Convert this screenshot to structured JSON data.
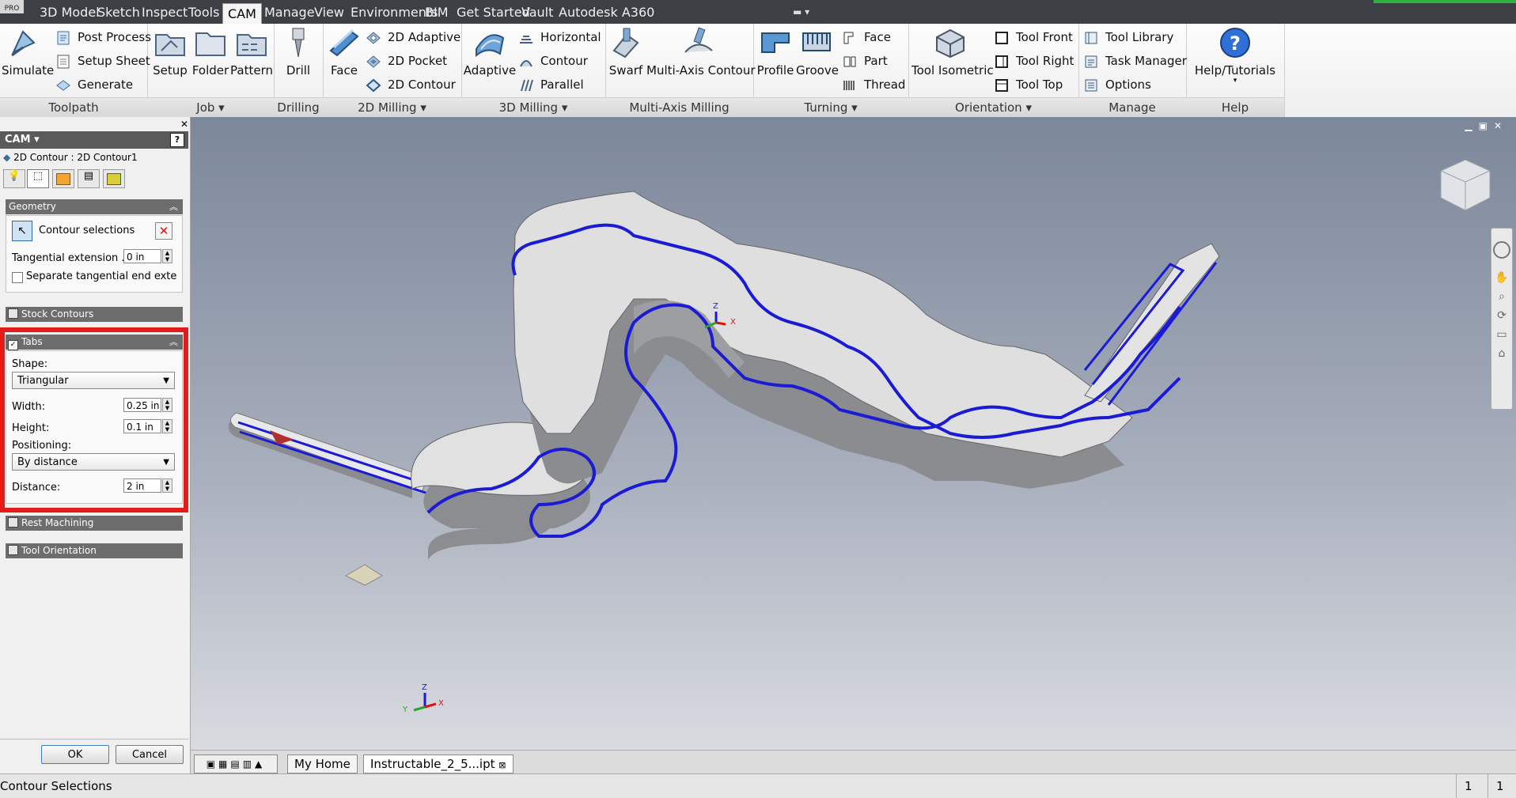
{
  "tabbar": {
    "pro_badge": "PRO",
    "tabs": [
      "3D Model",
      "Sketch",
      "Inspect",
      "Tools",
      "CAM",
      "Manage",
      "View",
      "Environments",
      "BIM",
      "Get Started",
      "Vault",
      "Autodesk A360"
    ],
    "active_tab": "CAM"
  },
  "ribbon": {
    "toolpath": {
      "title": "Toolpath",
      "simulate": "Simulate",
      "post_process": "Post Process",
      "setup_sheet": "Setup Sheet",
      "generate": "Generate"
    },
    "job": {
      "title": "Job",
      "setup": "Setup",
      "folder": "Folder",
      "pattern": "Pattern"
    },
    "drilling": {
      "title": "Drilling",
      "drill": "Drill"
    },
    "milling2d": {
      "title": "2D Milling",
      "face": "Face",
      "adaptive": "2D Adaptive",
      "pocket": "2D Pocket",
      "contour": "2D Contour"
    },
    "milling3d": {
      "title": "3D Milling",
      "adaptive": "Adaptive",
      "horizontal": "Horizontal",
      "contour": "Contour",
      "parallel": "Parallel"
    },
    "multiaxis": {
      "title": "Multi-Axis Milling",
      "swarf": "Swarf",
      "contour": "Multi-Axis Contour"
    },
    "turning": {
      "title": "Turning",
      "profile": "Profile",
      "groove": "Groove",
      "face": "Face",
      "part": "Part",
      "thread": "Thread"
    },
    "orientation": {
      "title": "Orientation",
      "isometric": "Tool Isometric",
      "front": "Tool Front",
      "right": "Tool Right",
      "top": "Tool Top"
    },
    "manage": {
      "title": "Manage",
      "library": "Tool Library",
      "task_manager": "Task Manager",
      "options": "Options"
    },
    "help": {
      "title": "Help",
      "tutorials": "Help/Tutorials"
    }
  },
  "panel": {
    "header": "CAM",
    "operation": "2D Contour : 2D Contour1",
    "geometry": {
      "title": "Geometry",
      "contour_selections": "Contour selections",
      "tangential_label": "Tangential extension ...",
      "tangential_value": "0 in",
      "separate_label": "Separate tangential end extensio"
    },
    "stock_contours": "Stock Contours",
    "tabs": {
      "title": "Tabs",
      "shape_label": "Shape:",
      "shape_value": "Triangular",
      "width_label": "Width:",
      "width_value": "0.25 in",
      "height_label": "Height:",
      "height_value": "0.1 in",
      "positioning_label": "Positioning:",
      "positioning_value": "By distance",
      "distance_label": "Distance:",
      "distance_value": "2 in"
    },
    "rest_machining": "Rest Machining",
    "tool_orientation": "Tool Orientation",
    "ok": "OK",
    "cancel": "Cancel"
  },
  "doc_tabs": {
    "home": "My Home",
    "file": "Instructable_2_5...ipt"
  },
  "status": {
    "text": "Contour Selections",
    "v1": "1",
    "v2": "1"
  },
  "axis": {
    "x": "X",
    "y": "Y",
    "z": "Z"
  },
  "colors": {
    "accent_red": "#e31b1b",
    "contour_blue": "#1b1bd6",
    "part_face": "#d9d9d9"
  }
}
